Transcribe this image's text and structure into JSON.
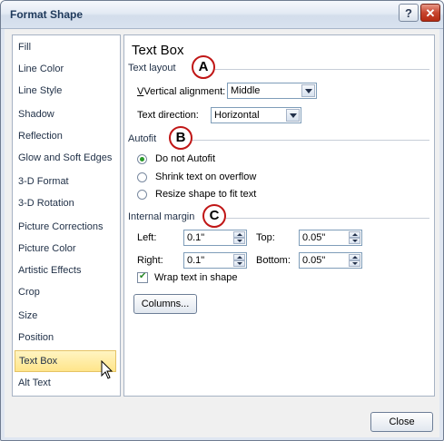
{
  "window": {
    "title": "Format Shape",
    "help_label": "?",
    "close_label": "✕"
  },
  "nav": {
    "items": [
      {
        "label": "Fill"
      },
      {
        "label": "Line Color"
      },
      {
        "label": "Line Style"
      },
      {
        "label": "Shadow"
      },
      {
        "label": "Reflection"
      },
      {
        "label": "Glow and Soft Edges"
      },
      {
        "label": "3-D Format"
      },
      {
        "label": "3-D Rotation"
      },
      {
        "label": "Picture Corrections"
      },
      {
        "label": "Picture Color"
      },
      {
        "label": "Artistic Effects"
      },
      {
        "label": "Crop"
      },
      {
        "label": "Size"
      },
      {
        "label": "Position"
      },
      {
        "label": "Text Box"
      },
      {
        "label": "Alt Text"
      }
    ],
    "selected": "Text Box"
  },
  "panel": {
    "title": "Text Box",
    "text_layout": {
      "heading": "Text layout",
      "vertical_alignment_label": "Vertical alignment:",
      "vertical_alignment_value": "Middle",
      "text_direction_label": "Text direction:",
      "text_direction_value": "Horizontal"
    },
    "autofit": {
      "heading": "Autofit",
      "options": [
        "Do not Autofit",
        "Shrink text on overflow",
        "Resize shape to fit text"
      ],
      "selected": "Do not Autofit"
    },
    "internal_margin": {
      "heading": "Internal margin",
      "left_label": "Left:",
      "left_value": "0.1\"",
      "top_label": "Top:",
      "top_value": "0.05\"",
      "right_label": "Right:",
      "right_value": "0.1\"",
      "bottom_label": "Bottom:",
      "bottom_value": "0.05\""
    },
    "wrap_label": "Wrap text in shape",
    "wrap_checked": true,
    "columns_label": "Columns..."
  },
  "callouts": {
    "a": "A",
    "b": "B",
    "c": "C"
  },
  "footer": {
    "close_label": "Close"
  }
}
